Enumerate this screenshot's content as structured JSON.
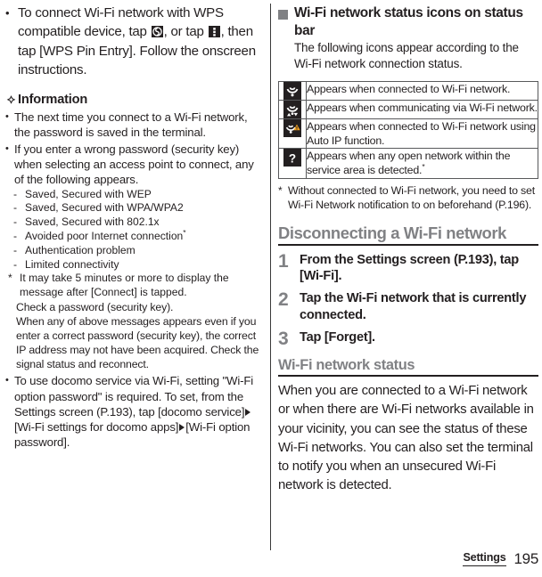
{
  "document": {
    "footer": {
      "section_label": "Settings",
      "page_number": "195"
    }
  },
  "left_column": {
    "lead_bullet": {
      "marker": "•",
      "text_part1": "To connect Wi-Fi network with WPS compatible device, tap ",
      "icon1": "wps-circular-arrow-icon",
      "text_part2": ", or tap ",
      "icon2": "overflow-menu-dots-icon",
      "text_part3": ", then tap [WPS Pin Entry]. Follow the onscreen instructions."
    },
    "information_heading": "Information",
    "information_marker": "❖",
    "bullets": [
      "The next time you connect to a Wi-Fi network, the password is saved in the terminal.",
      "If you enter a wrong password (security key) when selecting an access point to connect, any of the following appears."
    ],
    "dash_items": [
      "Saved, Secured with WEP",
      "Saved, Secured with WPA/WPA2",
      "Saved, Secured with 802.1x",
      "Avoided poor Internet connection",
      "Authentication problem",
      "Limited connectivity"
    ],
    "dash_item_footnote_index": 3,
    "footnote_marker": "*",
    "footnote_text": "It may take 5 minutes or more to display the message after [Connect] is tapped.",
    "plain_paragraphs": [
      "Check a password (security key).",
      "When any of above messages appears even if you enter a correct password (security key), the correct IP address may not have been acquired. Check the signal status and reconnect."
    ],
    "last_bullet": {
      "marker": "•",
      "part1": "To use docomo service via Wi-Fi, setting \"Wi-Fi option password\" is required. To set, from the Settings screen (P.193), tap [docomo service]",
      "arrow": "▶",
      "part2": "[Wi-Fi settings for docomo apps]",
      "part3": "[Wi-Fi option password]."
    }
  },
  "right_column": {
    "status_icons_section": {
      "heading": "Wi-Fi network status icons on status bar",
      "intro": "The following icons appear according to the Wi-Fi network connection status.",
      "table": {
        "rows": [
          {
            "icon": "wifi-connected-icon",
            "description": "Appears when connected to Wi-Fi network."
          },
          {
            "icon": "wifi-communicating-icon",
            "description": "Appears when communicating via Wi-Fi network."
          },
          {
            "icon": "wifi-auto-ip-warning-icon",
            "description": "Appears when connected to Wi-Fi network using Auto IP function."
          },
          {
            "icon": "wifi-open-network-question-icon",
            "description": "Appears when any open network within the service area is detected."
          }
        ]
      },
      "table_row4_footnote_marker": "*",
      "footnote_marker": "*",
      "footnote": "Without connected to Wi-Fi network, you need to set Wi-Fi Network notification to on beforehand (P.196)."
    },
    "disconnecting_section": {
      "heading": "Disconnecting a Wi-Fi network",
      "steps": [
        {
          "number": "1",
          "text": "From the Settings screen (P.193), tap [Wi-Fi]."
        },
        {
          "number": "2",
          "text": "Tap the Wi-Fi network that is currently connected."
        },
        {
          "number": "3",
          "text": "Tap [Forget]."
        }
      ]
    },
    "status_section": {
      "heading": "Wi-Fi network status",
      "body": "When you are connected to a Wi-Fi network or when there are Wi-Fi networks available in your vicinity, you can see the status of these Wi-Fi networks. You can also set the terminal to notify you when an unsecured Wi-Fi network is detected."
    }
  },
  "colors": {
    "heading_gray": "#808184",
    "text_black": "#231f20",
    "rule_black": "#231f20",
    "warning_orange": "#f0a020",
    "icon_badge_dark": "#231f20"
  }
}
